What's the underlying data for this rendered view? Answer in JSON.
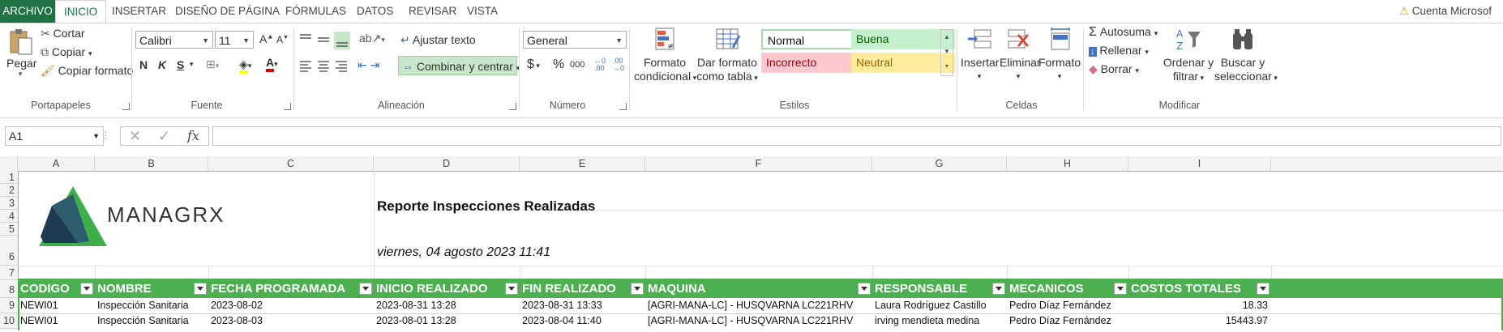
{
  "tabs": [
    "ARCHIVO",
    "INICIO",
    "INSERTAR",
    "DISEÑO DE PÁGINA",
    "FÓRMULAS",
    "DATOS",
    "REVISAR",
    "VISTA"
  ],
  "account": "Cuenta Microsof",
  "ribbon": {
    "clipboard": {
      "paste": "Pegar",
      "cut": "Cortar",
      "copy": "Copiar",
      "format_painter": "Copiar formato",
      "label": "Portapapeles"
    },
    "font": {
      "name": "Calibri",
      "size": "11",
      "label": "Fuente",
      "bold": "N",
      "italic": "K",
      "underline": "S"
    },
    "alignment": {
      "wrap": "Ajustar texto",
      "merge": "Combinar y centrar",
      "label": "Alineación"
    },
    "number": {
      "format": "General",
      "label": "Número",
      "currency": "$",
      "percent": "%",
      "thousands": "000"
    },
    "styles": {
      "cond_format_1": "Formato",
      "cond_format_2": "condicional",
      "as_table_1": "Dar formato",
      "as_table_2": "como tabla",
      "normal": "Normal",
      "good": "Buena",
      "bad": "Incorrecto",
      "neutral": "Neutral",
      "label": "Estilos"
    },
    "cells": {
      "insert": "Insertar",
      "delete": "Eliminar",
      "format": "Formato",
      "label": "Celdas"
    },
    "editing": {
      "autosum": "Autosuma",
      "fill": "Rellenar",
      "clear": "Borrar",
      "sort_1": "Ordenar y",
      "sort_2": "filtrar",
      "find_1": "Buscar y",
      "find_2": "seleccionar",
      "label": "Modificar"
    }
  },
  "formula_bar": {
    "name_box": "A1",
    "fx": "fx",
    "value": ""
  },
  "columns": [
    "A",
    "B",
    "C",
    "D",
    "E",
    "F",
    "G",
    "H",
    "I"
  ],
  "rows": [
    "1",
    "2",
    "3",
    "4",
    "5",
    "6",
    "7",
    "8",
    "9",
    "10"
  ],
  "sheet": {
    "logo_text": "MANAGRX",
    "title": "Reporte Inspecciones Realizadas",
    "date": "viernes, 04 agosto 2023 11:41",
    "headers": [
      "CODIGO",
      "NOMBRE",
      "FECHA PROGRAMADA",
      "INICIO REALIZADO",
      "FIN REALIZADO",
      "MAQUINA",
      "RESPONSABLE",
      "MECANICOS",
      "COSTOS TOTALES"
    ],
    "data": [
      [
        "NEWI01",
        "Inspección Sanitaria",
        "2023-08-02",
        "2023-08-31 13:28",
        "2023-08-31 13:33",
        "[AGRI-MANA-LC] - HUSQVARNA LC221RHV",
        "Laura Rodríguez Castillo",
        "Pedro Díaz Fernández",
        "18.33"
      ],
      [
        "NEWI01",
        "Inspección Sanitaria",
        "2023-08-03",
        "2023-08-01 13:28",
        "2023-08-04 11:40",
        "[AGRI-MANA-LC] - HUSQVARNA LC221RHV",
        "irving mendieta medina",
        "Pedro Díaz Fernández",
        "15443.97"
      ]
    ]
  },
  "colors": {
    "excel_green": "#217346",
    "header_green": "#4caf50",
    "good_bg": "#c6efce",
    "bad_bg": "#ffc7ce",
    "neutral_bg": "#ffeb9c"
  }
}
